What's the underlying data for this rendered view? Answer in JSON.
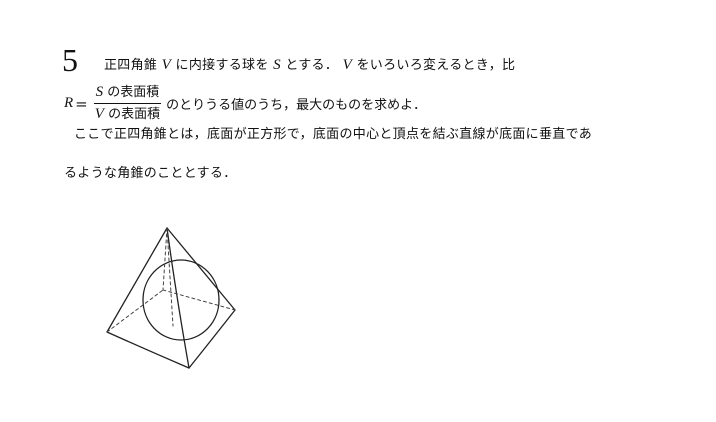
{
  "problem": {
    "number": "5",
    "line1": {
      "a": "正四角錐",
      "v1": "V",
      "b": "に内接する球を",
      "s1": "S",
      "c": "とする．",
      "v2": "V",
      "d": "をいろいろ変えるとき，比"
    },
    "formula": {
      "lhs": "R",
      "eq": "=",
      "num_var": "S",
      "num_text": "の表面積",
      "den_var": "V",
      "den_text": "の表面積",
      "tail": "のとりうる値のうち，最大のものを求めよ．"
    },
    "line3": "ここで正四角錐とは，底面が正方形で，底面の中心と頂点を結ぶ直線が底面に垂直であ",
    "line4": "るような角錐のこととする．"
  }
}
